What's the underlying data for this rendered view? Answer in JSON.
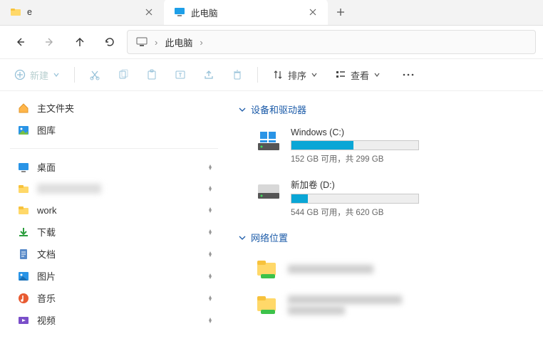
{
  "tabs": [
    {
      "title": "e",
      "active": false
    },
    {
      "title": "此电脑",
      "active": true
    }
  ],
  "addr": {
    "crumb1": "此电脑"
  },
  "toolbar": {
    "new": "新建",
    "sort": "排序",
    "view": "查看"
  },
  "sidebar": {
    "top": [
      {
        "label": "主文件夹",
        "icon": "home"
      },
      {
        "label": "图库",
        "icon": "gallery"
      }
    ],
    "pinned": [
      {
        "label": "桌面",
        "icon": "desktop"
      },
      {
        "label": "",
        "icon": "folder",
        "redacted": true
      },
      {
        "label": "work",
        "icon": "folder"
      },
      {
        "label": "下载",
        "icon": "download"
      },
      {
        "label": "文档",
        "icon": "docs"
      },
      {
        "label": "图片",
        "icon": "pics"
      },
      {
        "label": "音乐",
        "icon": "music"
      },
      {
        "label": "视频",
        "icon": "video"
      }
    ]
  },
  "main": {
    "group1": "设备和驱动器",
    "drives": [
      {
        "name": "Windows (C:)",
        "sub": "152 GB 可用，共 299 GB",
        "fill": 49,
        "type": "os"
      },
      {
        "name": "新加卷 (D:)",
        "sub": "544 GB 可用，共 620 GB",
        "fill": 13,
        "type": "hd"
      }
    ],
    "group2": "网络位置"
  }
}
